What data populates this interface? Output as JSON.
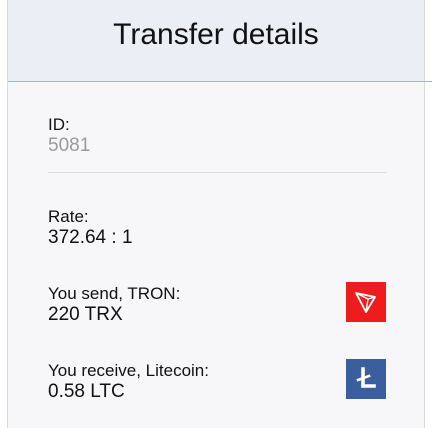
{
  "header": {
    "title": "Transfer details"
  },
  "details": {
    "id_label": "ID:",
    "id_value": "5081",
    "rate_label": "Rate:",
    "rate_value": "372.64 : 1",
    "send_label": "You send, TRON:",
    "send_value": "220 TRX",
    "receive_label": "You receive, Litecoin:",
    "receive_value": "0.58 LTC"
  },
  "icons": {
    "send_coin": "tron-icon",
    "receive_coin": "litecoin-icon"
  },
  "colors": {
    "accent": "#a6cf38",
    "tron": "#ee1c1c",
    "litecoin": "#3b5f9e",
    "muted_text": "#9a9a9a"
  }
}
